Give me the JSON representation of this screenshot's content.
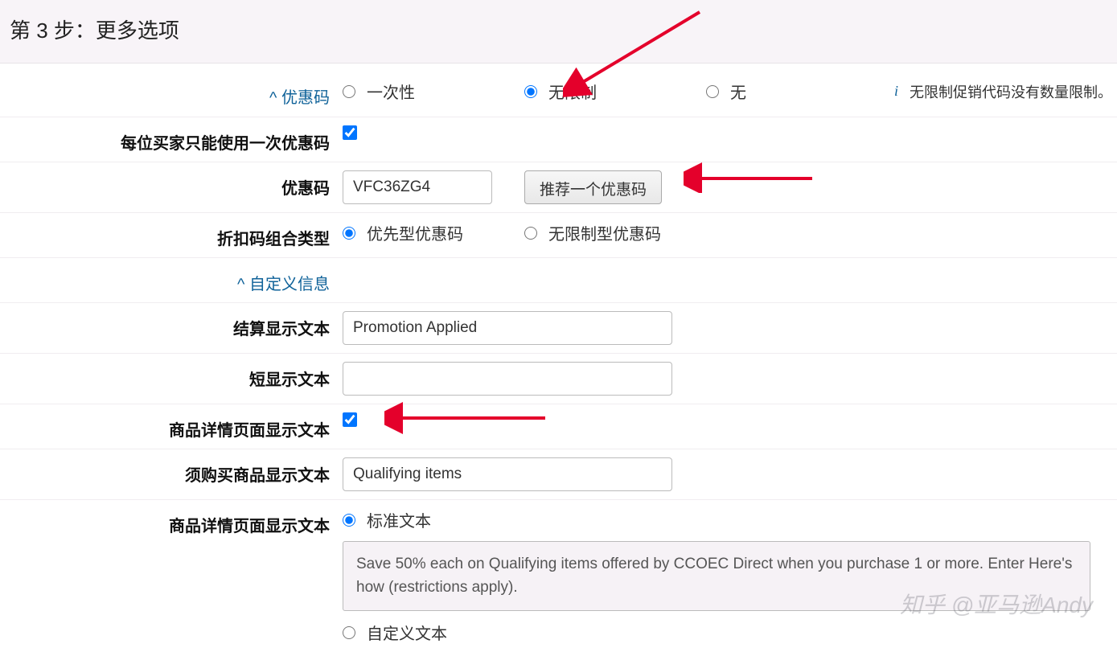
{
  "header": {
    "step_title": "第 3 步：更多选项"
  },
  "sections": {
    "promo_code_section": {
      "label": "优惠码"
    },
    "custom_info_section": {
      "label": "自定义信息"
    }
  },
  "rows": {
    "usage": {
      "options": {
        "once": "一次性",
        "unlimited": "无限制",
        "none": "无"
      },
      "info": "无限制促销代码没有数量限制。"
    },
    "one_per_buyer": {
      "label": "每位买家只能使用一次优惠码",
      "checked": true
    },
    "promo_code": {
      "label": "优惠码",
      "value": "VFC36ZG4",
      "suggest_btn": "推荐一个优惠码"
    },
    "combo_type": {
      "label": "折扣码组合类型",
      "options": {
        "priority": "优先型优惠码",
        "unlimited": "无限制型优惠码"
      }
    },
    "checkout_text": {
      "label": "结算显示文本",
      "value": "Promotion Applied"
    },
    "short_text": {
      "label": "短显示文本",
      "value": ""
    },
    "detail_page_show": {
      "label": "商品详情页面显示文本",
      "checked": true
    },
    "qualifying": {
      "label": "须购买商品显示文本",
      "value": "Qualifying items"
    },
    "detail_text": {
      "label": "商品详情页面显示文本",
      "options": {
        "standard": "标准文本",
        "custom": "自定义文本"
      },
      "standard_body": "Save 50% each on Qualifying items offered by CCOEC Direct when you purchase 1 or more. Enter Here's how (restrictions apply)."
    }
  },
  "watermark": "知乎 @亚马逊Andy"
}
